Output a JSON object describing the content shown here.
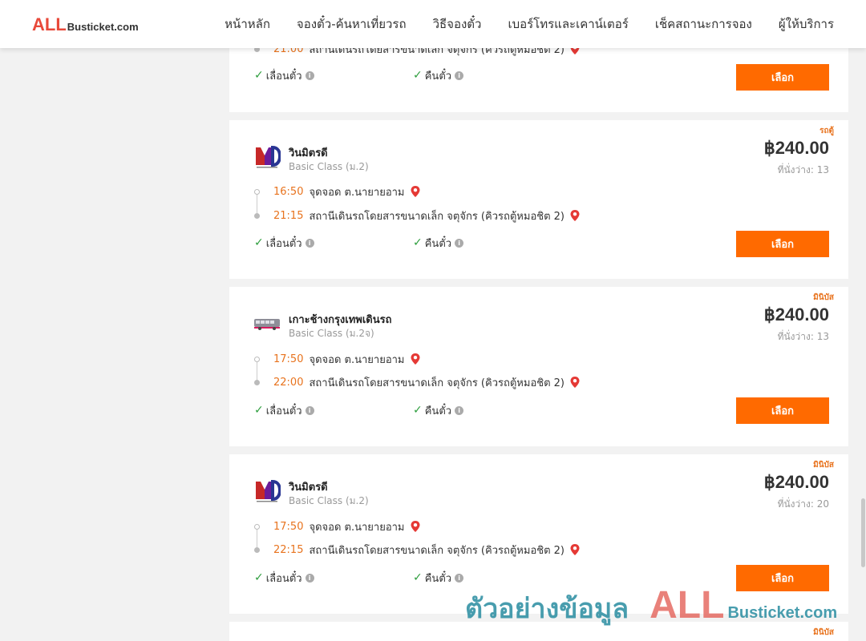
{
  "header": {
    "logo_all": "ALL",
    "logo_rest": "Busticket.com",
    "nav": [
      "หน้าหลัก",
      "จองตั๋ว-ค้นหาเที่ยวรถ",
      "วิธีจองตั๋ว",
      "เบอร์โทรและเคาน์เตอร์",
      "เช็คสถานะการจอง",
      "ผู้ให้บริการ"
    ]
  },
  "cards": [
    {
      "partial": true,
      "arrive_time": "21:00",
      "arrive_place": "สถานีเดินรถโดยสารขนาดเล็ก จตุจักร (คิวรถตู้หมอชิต 2)",
      "feature_1": "เลื่อนตั๋ว",
      "feature_2": "คืนตั๋ว",
      "button": "เลือก"
    },
    {
      "type": "รถตู้",
      "operator": "วินมิตรดี",
      "class": "Basic Class (ม.2)",
      "price": "฿240.00",
      "seats": "ที่นั่งว่าง: 13",
      "depart_time": "16:50",
      "depart_place": "จุดจอด ต.นายายอาม",
      "arrive_time": "21:15",
      "arrive_place": "สถานีเดินรถโดยสารขนาดเล็ก จตุจักร (คิวรถตู้หมอชิต 2)",
      "feature_1": "เลื่อนตั๋ว",
      "feature_2": "คืนตั๋ว",
      "button": "เลือก",
      "logo": "md-logo-icon"
    },
    {
      "type": "มินิบัส",
      "operator": "เกาะช้างกรุงเทพเดินรถ",
      "class": "Basic Class (ม.2จ)",
      "price": "฿240.00",
      "seats": "ที่นั่งว่าง: 13",
      "depart_time": "17:50",
      "depart_place": "จุดจอด ต.นายายอาม",
      "arrive_time": "22:00",
      "arrive_place": "สถานีเดินรถโดยสารขนาดเล็ก จตุจักร (คิวรถตู้หมอชิต 2)",
      "feature_1": "เลื่อนตั๋ว",
      "feature_2": "คืนตั๋ว",
      "button": "เลือก",
      "logo": "bus-logo-icon"
    },
    {
      "type": "มินิบัส",
      "operator": "วินมิตรดี",
      "class": "Basic Class (ม.2)",
      "price": "฿240.00",
      "seats": "ที่นั่งว่าง: 20",
      "depart_time": "17:50",
      "depart_place": "จุดจอด ต.นายายอาม",
      "arrive_time": "22:15",
      "arrive_place": "สถานีเดินรถโดยสารขนาดเล็ก จตุจักร (คิวรถตู้หมอชิต 2)",
      "feature_1": "เลื่อนตั๋ว",
      "feature_2": "คืนตั๋ว",
      "button": "เลือก",
      "logo": "md-logo-icon"
    },
    {
      "partial": true,
      "type": "มินิบัส"
    }
  ],
  "watermark": {
    "text": "ตัวอย่างข้อมูล",
    "all": "ALL",
    "rest": "Busticket.com"
  },
  "colors": {
    "accent": "#ff6a00",
    "time": "#e8731e",
    "check": "#2e9e3e",
    "pin": "#e53935"
  }
}
